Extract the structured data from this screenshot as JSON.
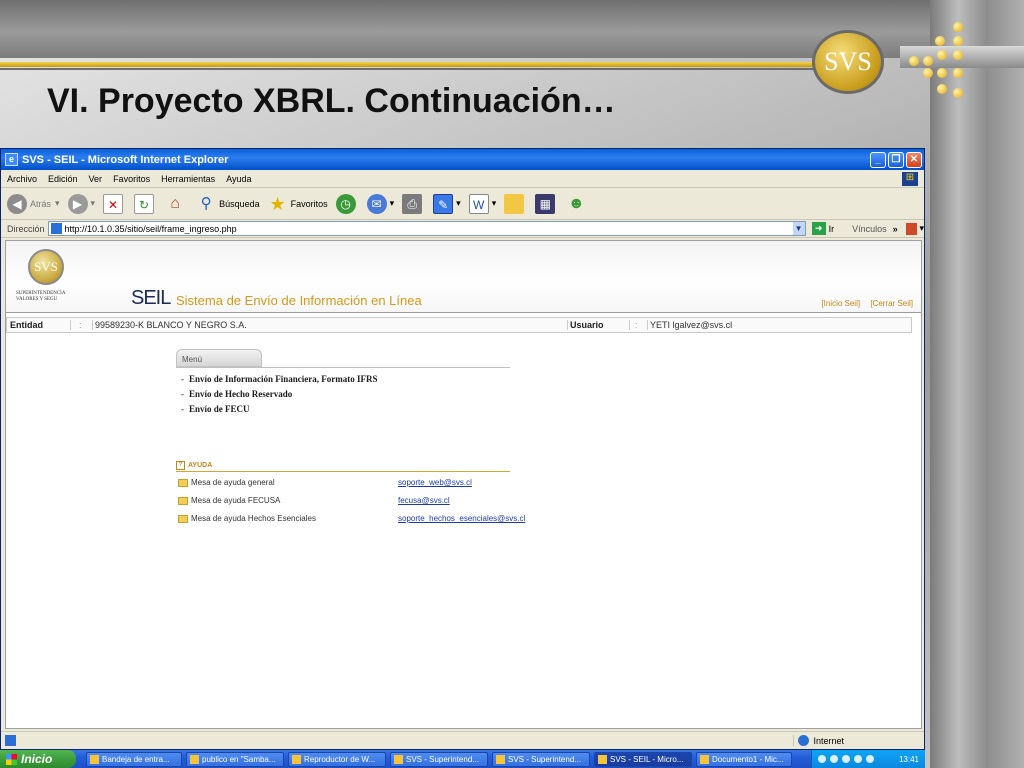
{
  "slide": {
    "title": "VI. Proyecto XBRL. Continuación…",
    "logo_text": "SVS"
  },
  "window": {
    "title": "SVS - SEIL - Microsoft Internet Explorer",
    "menu": [
      "Archivo",
      "Edición",
      "Ver",
      "Favoritos",
      "Herramientas",
      "Ayuda"
    ],
    "toolbar": {
      "back": "Atrás",
      "search": "Búsqueda",
      "favorites": "Favoritos"
    },
    "address": {
      "label": "Dirección",
      "url": "http://10.1.0.35/sitio/seil/frame_ingreso.php",
      "go": "Ir",
      "links": "Vínculos"
    },
    "status": {
      "zone": "Internet"
    }
  },
  "page": {
    "logo": "SVS",
    "logo_caption": "SUPERINTENDENCIA VALORES Y SEGU",
    "brand": "SEIL",
    "subtitle": "Sistema de Envío de Información en Línea",
    "links": [
      "[Inicio Seil]",
      "[Cerrar Seil]"
    ],
    "info": {
      "entidad_label": "Entidad",
      "entidad_value": "99589230-K  BLANCO Y NEGRO S.A.",
      "usuario_label": "Usuario",
      "usuario_value": "YETI  lgalvez@svs.cl",
      "separator": ":"
    },
    "menu": {
      "tab": "Menú",
      "items": [
        "Envío de Información Financiera, Formato IFRS",
        "Envío de Hecho Reservado",
        "Envío de FECU"
      ]
    },
    "help": {
      "heading": "AYUDA",
      "rows": [
        {
          "label": "Mesa de ayuda general",
          "email": "soporte_web@svs.cl"
        },
        {
          "label": "Mesa de ayuda FECUSA",
          "email": "fecusa@svs.cl"
        },
        {
          "label": "Mesa de ayuda Hechos Esenciales",
          "email": "soporte_hechos_esenciales@svs.cl"
        }
      ]
    }
  },
  "taskbar": {
    "start": "Inicio",
    "tasks": [
      {
        "label": "Bandeja de entra...",
        "active": false
      },
      {
        "label": "publico en \"Samba...",
        "active": false
      },
      {
        "label": "Reproductor de W...",
        "active": false
      },
      {
        "label": "SVS - Superintend...",
        "active": false
      },
      {
        "label": "SVS - Superintend...",
        "active": false
      },
      {
        "label": "SVS - SEIL - Micro...",
        "active": true
      },
      {
        "label": "Documento1 - Mic...",
        "active": false
      }
    ],
    "clock": "13:41"
  }
}
